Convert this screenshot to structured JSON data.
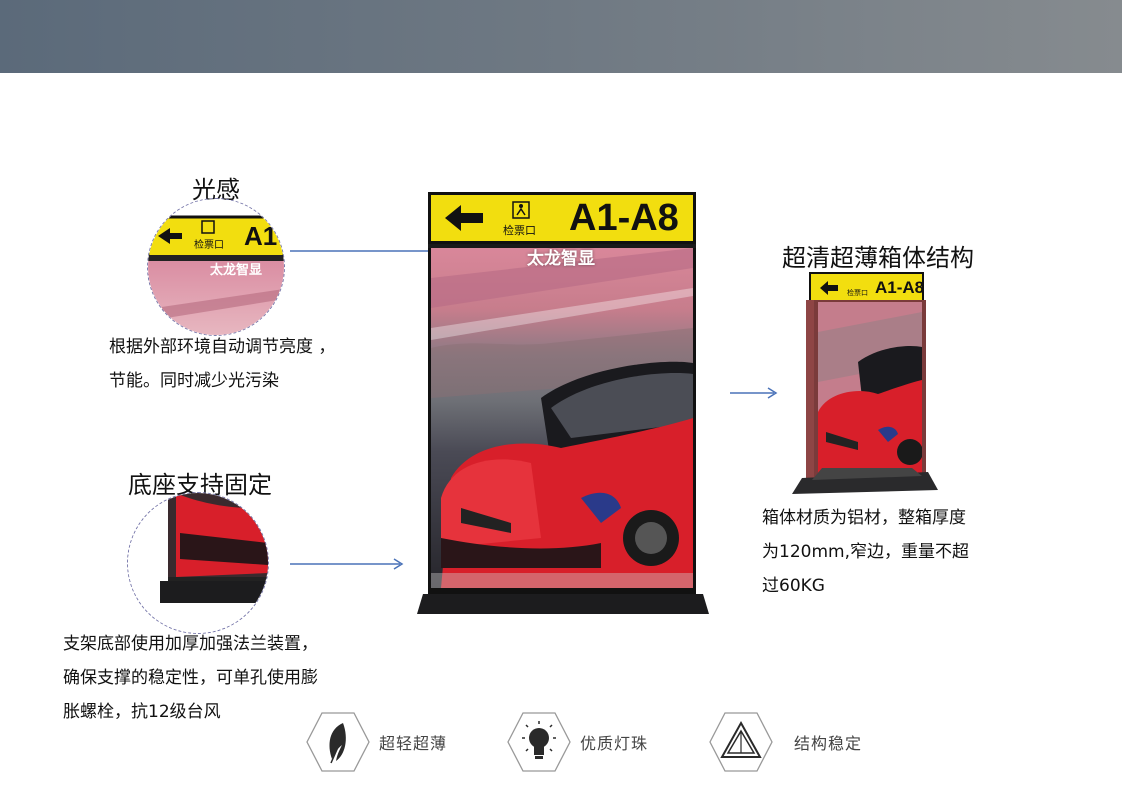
{
  "sections": {
    "light_sense": {
      "title": "光感",
      "lines": [
        "根据外部环境自动调节亮度 ，",
        "节能。同时减少光污染"
      ]
    },
    "base": {
      "title": "底座支持固定",
      "lines": [
        "支架底部使用加厚加强法兰装置，",
        "确保支撑的稳定性，可单孔使用膨",
        "胀螺栓，抗12级台风"
      ]
    },
    "cabinet": {
      "title": "超清超薄箱体结构",
      "lines": [
        "箱体材质为铝材，整箱厚度",
        "为120mm,窄边，重量不超",
        "过60KG"
      ]
    }
  },
  "sign": {
    "code": "A1-A8",
    "gate_label": "检票口",
    "brand": "太龙智显",
    "sign_color": "#f2de0f"
  },
  "features": [
    {
      "label": "超轻超薄",
      "icon": "feather-icon"
    },
    {
      "label": "优质灯珠",
      "icon": "lightbulb-icon"
    },
    {
      "label": "结构稳定",
      "icon": "triangle-icon"
    }
  ],
  "colors": {
    "arrow": "#4a72b8",
    "car_red": "#d81f2a"
  }
}
